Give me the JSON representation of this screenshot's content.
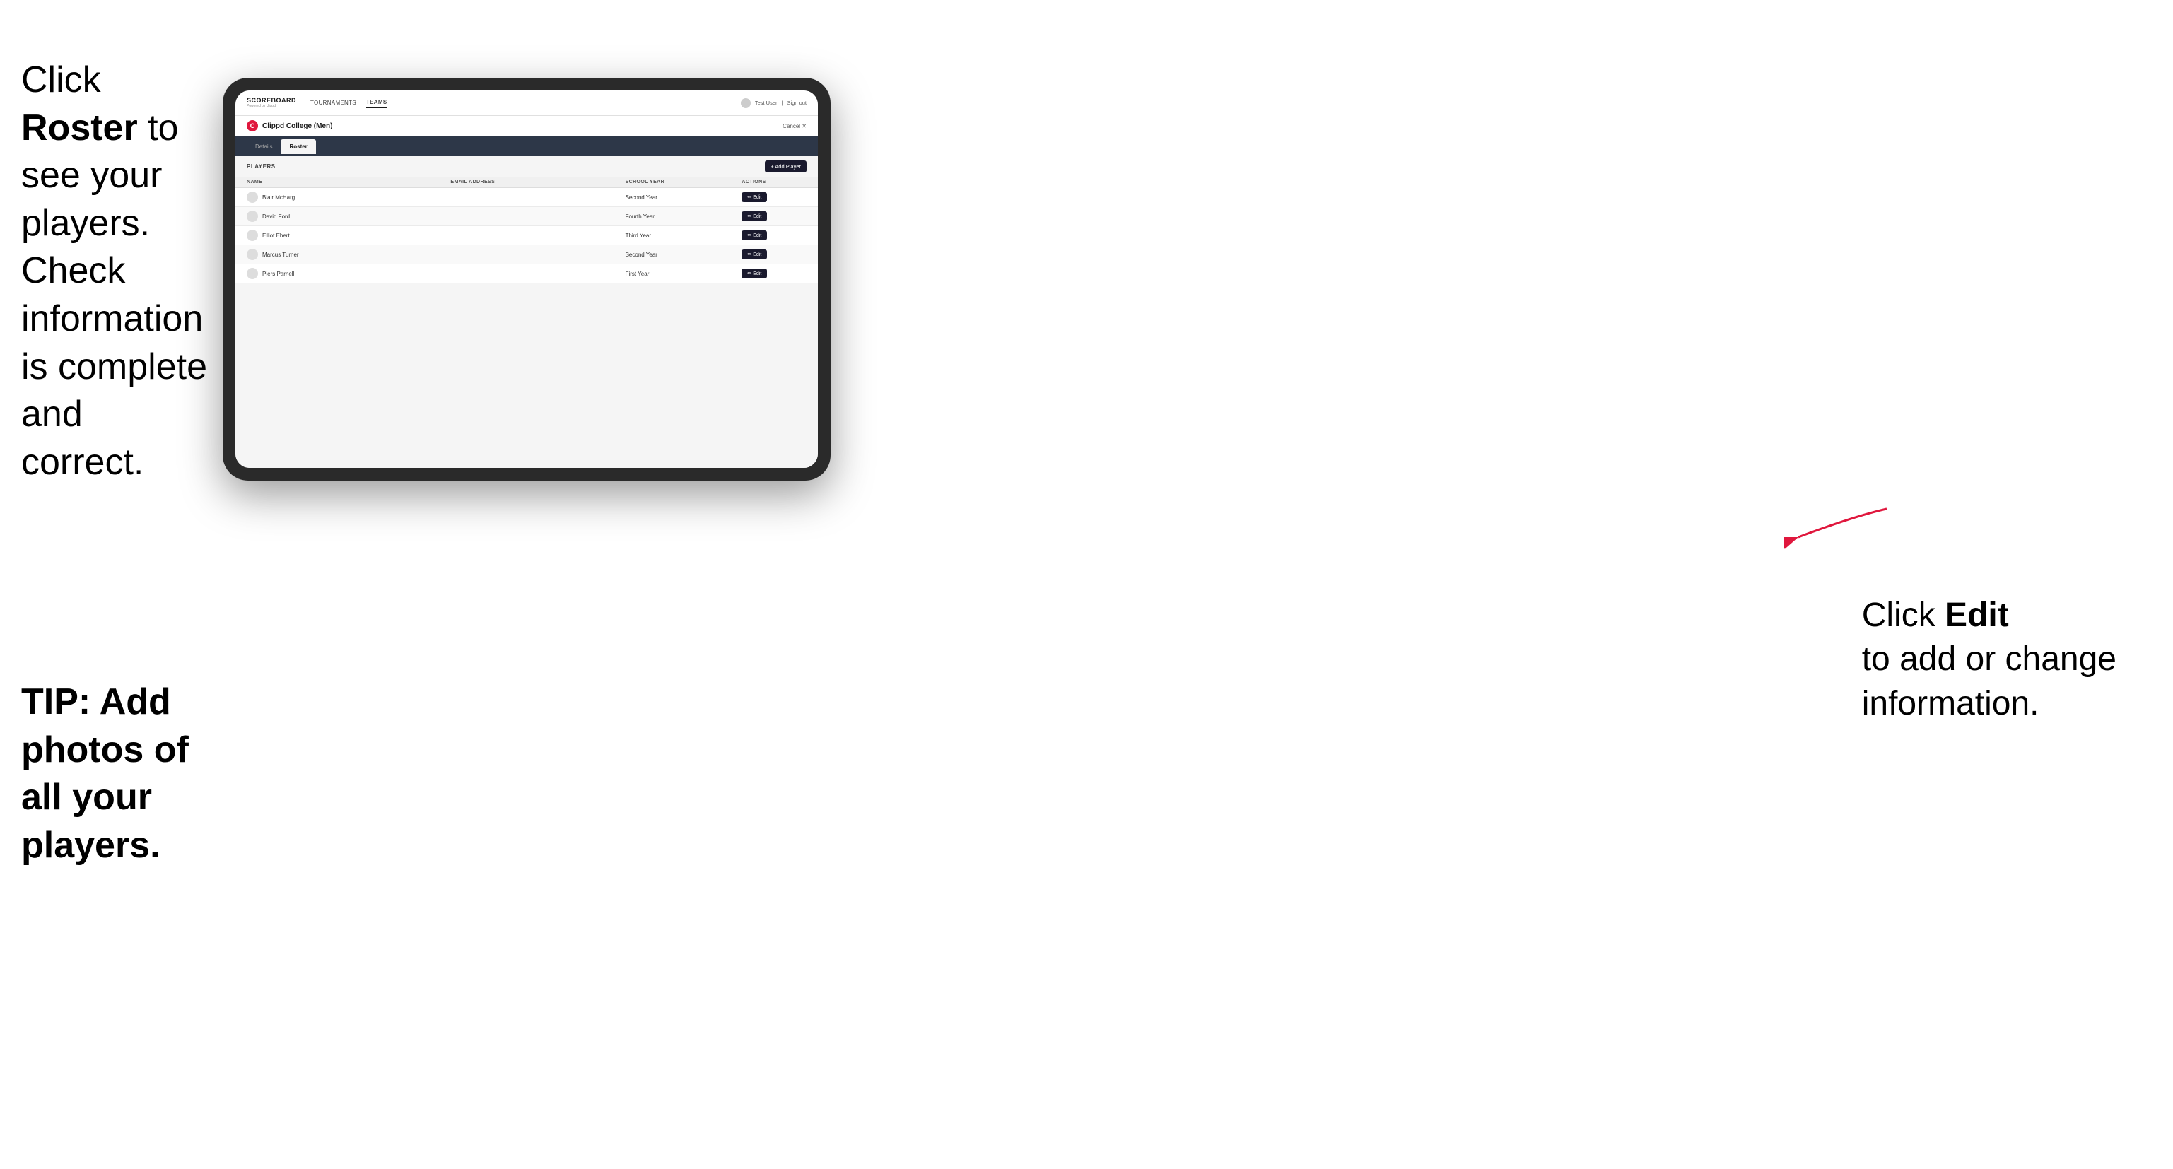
{
  "left_annotation": {
    "line1": "Click ",
    "bold1": "Roster",
    "line2": " to",
    "line3": "see your players.",
    "line4": "Check information",
    "line5": "is complete and",
    "line6": "correct."
  },
  "tip_annotation": {
    "text": "TIP: Add photos of all your players."
  },
  "right_annotation": {
    "line1": "Click ",
    "bold1": "Edit",
    "line2": "to add or change",
    "line3": "information."
  },
  "nav": {
    "logo": "SCOREBOARD",
    "logo_sub": "Powered by clippd",
    "items": [
      "TOURNAMENTS",
      "TEAMS"
    ],
    "active_item": "TEAMS",
    "user": "Test User",
    "sign_out": "Sign out"
  },
  "team": {
    "name": "Clippd College (Men)",
    "cancel_label": "Cancel ✕"
  },
  "tabs": [
    {
      "label": "Details",
      "active": false
    },
    {
      "label": "Roster",
      "active": true
    }
  ],
  "players_section": {
    "label": "PLAYERS",
    "add_button": "+ Add Player"
  },
  "table": {
    "columns": [
      "NAME",
      "EMAIL ADDRESS",
      "SCHOOL YEAR",
      "ACTIONS"
    ],
    "rows": [
      {
        "name": "Blair McHarg",
        "email": "",
        "year": "Second Year",
        "action": "Edit"
      },
      {
        "name": "David Ford",
        "email": "",
        "year": "Fourth Year",
        "action": "Edit"
      },
      {
        "name": "Elliot Ebert",
        "email": "",
        "year": "Third Year",
        "action": "Edit"
      },
      {
        "name": "Marcus Turner",
        "email": "",
        "year": "Second Year",
        "action": "Edit"
      },
      {
        "name": "Piers Parnell",
        "email": "",
        "year": "First Year",
        "action": "Edit"
      }
    ]
  }
}
